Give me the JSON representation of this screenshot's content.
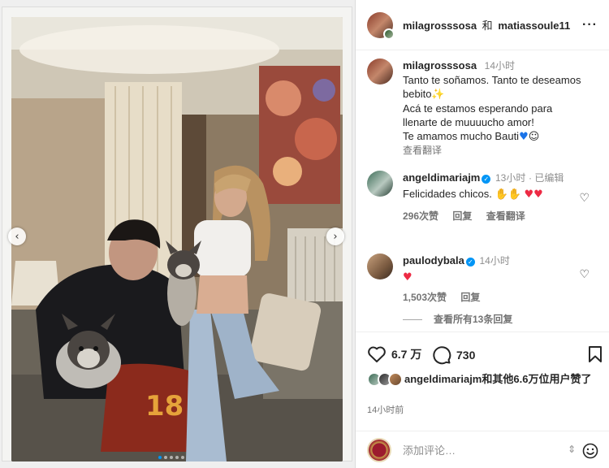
{
  "post": {
    "author": "milagrosssosa",
    "collab_joiner": "和",
    "collaborator": "matiassoule11",
    "more_icon": "more-horizontal-icon"
  },
  "caption": {
    "username": "milagrosssosa",
    "time": "14小时",
    "lines": [
      "Tanto te soñamos. Tanto te deseamos bebito",
      "Acá te estamos esperando para",
      "llenarte de muuuucho amor!",
      "Te amamos mucho Bauti"
    ],
    "emoji_after_line1": "✨",
    "see_translation": "查看翻译"
  },
  "comments": [
    {
      "username": "angeldimariajm",
      "verified": true,
      "time": "13小时",
      "edited": "· 已编辑",
      "text": "Felicidades chicos.",
      "emojis": "👏👏 ♥♥",
      "likes": "296次赞",
      "reply": "回复",
      "see_translation": "查看翻译"
    },
    {
      "username": "paulodybala",
      "verified": true,
      "time": "14小时",
      "text": "♥",
      "likes": "1,503次赞",
      "reply": "回复"
    }
  ],
  "view_replies": "查看所有13条回复",
  "actions": {
    "like_count": "6.7 万",
    "comment_count": "730"
  },
  "likes_summary": {
    "username": "angeldimariajm",
    "rest": "和其他6.6万位用户赞了"
  },
  "timestamp": "14小时前",
  "composer": {
    "placeholder": "添加评论…"
  },
  "colors": {
    "accent_blue": "#0095f6",
    "heart_red": "#ed2a44",
    "text_primary": "#262626",
    "text_secondary": "#737373"
  },
  "carousel": {
    "total_dots": 5,
    "active_index": 0
  }
}
